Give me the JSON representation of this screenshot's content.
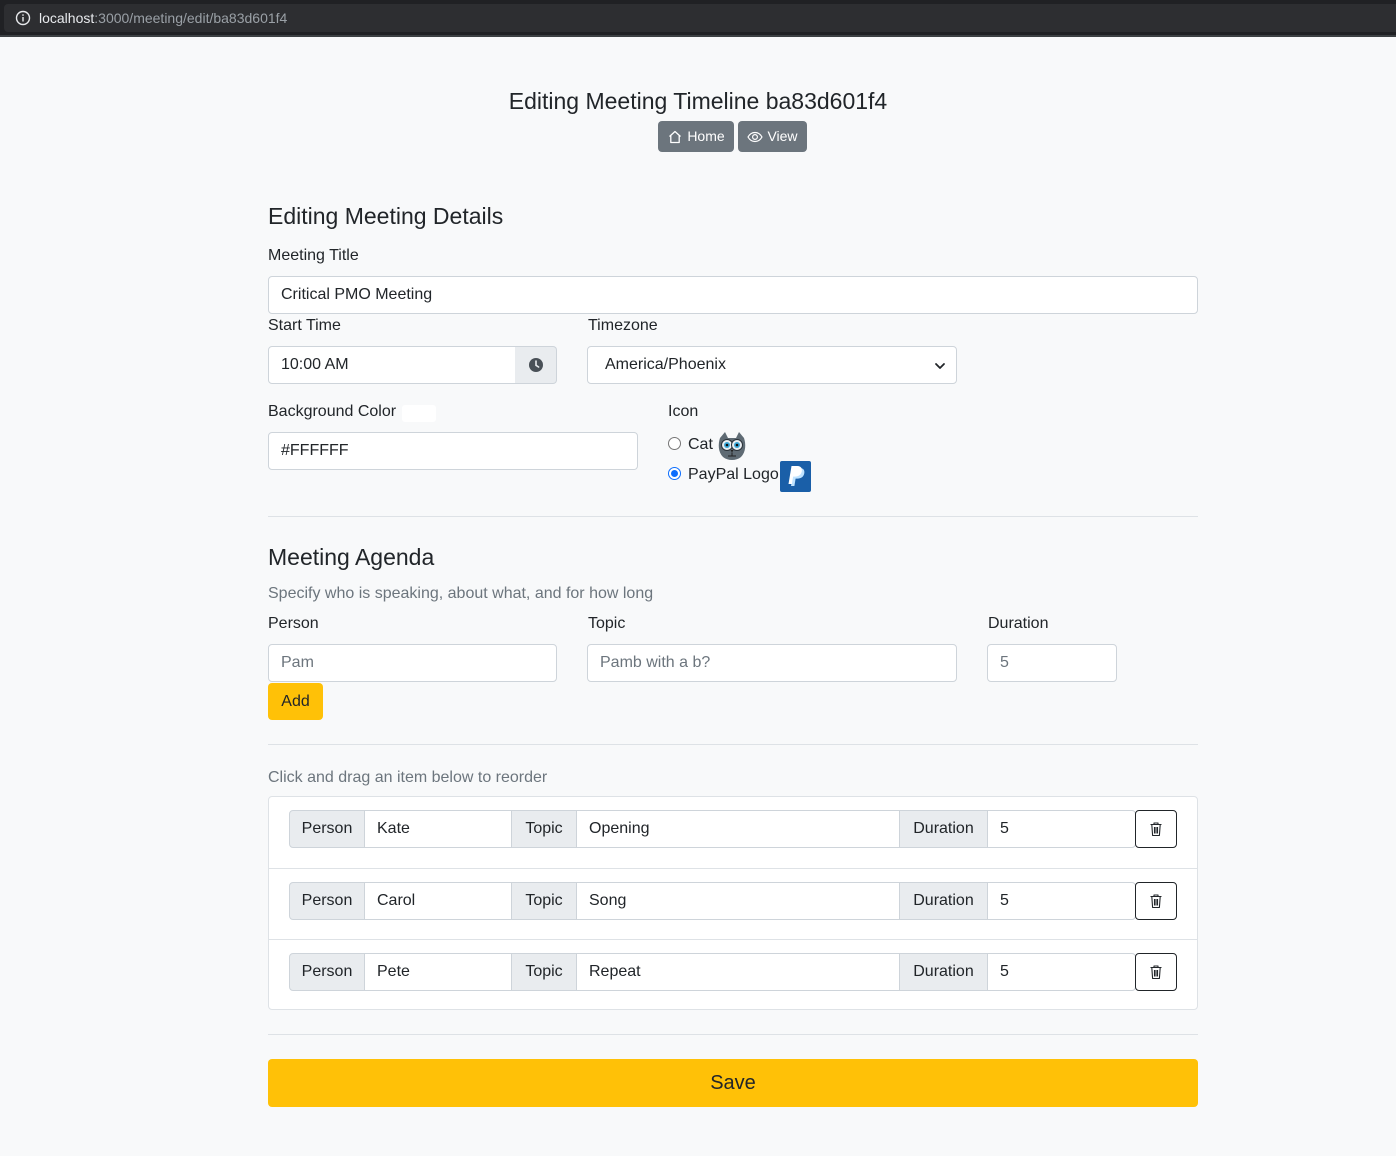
{
  "browser": {
    "url_host": "localhost",
    "url_path": ":3000/meeting/edit/ba83d601f4"
  },
  "header": {
    "title": "Editing Meeting Timeline ba83d601f4",
    "home_label": "Home",
    "view_label": "View"
  },
  "details": {
    "heading": "Editing Meeting Details",
    "meeting_title_label": "Meeting Title",
    "meeting_title_value": "Critical PMO Meeting",
    "start_time_label": "Start Time",
    "start_time_value": "10:00 AM",
    "timezone_label": "Timezone",
    "timezone_value": "America/Phoenix",
    "background_color_label": "Background Color",
    "background_color_value": "#FFFFFF",
    "icon_label": "Icon",
    "icon_options": [
      {
        "label": "Cat",
        "icon": "cat-icon",
        "checked": false
      },
      {
        "label": "PayPal Logo",
        "icon": "paypal-logo-icon",
        "checked": true
      }
    ]
  },
  "agenda": {
    "heading": "Meeting Agenda",
    "subtitle": "Specify who is speaking, about what, and for how long",
    "person_label": "Person",
    "person_placeholder": "Pam",
    "topic_label": "Topic",
    "topic_placeholder": "Pamb with a b?",
    "duration_label": "Duration",
    "duration_placeholder": "5",
    "add_label": "Add"
  },
  "reorder": {
    "hint": "Click and drag an item below to reorder",
    "person_addon": "Person",
    "topic_addon": "Topic",
    "duration_addon": "Duration",
    "items": [
      {
        "person": "Kate",
        "topic": "Opening",
        "duration": "5"
      },
      {
        "person": "Carol",
        "topic": "Song",
        "duration": "5"
      },
      {
        "person": "Pete",
        "topic": "Repeat",
        "duration": "5"
      }
    ]
  },
  "save_label": "Save",
  "colors": {
    "accent": "#ffc107",
    "secondary": "#6c757d",
    "radio_checked": "#0d6efd",
    "paypal_blue": "#1a5fa8"
  }
}
